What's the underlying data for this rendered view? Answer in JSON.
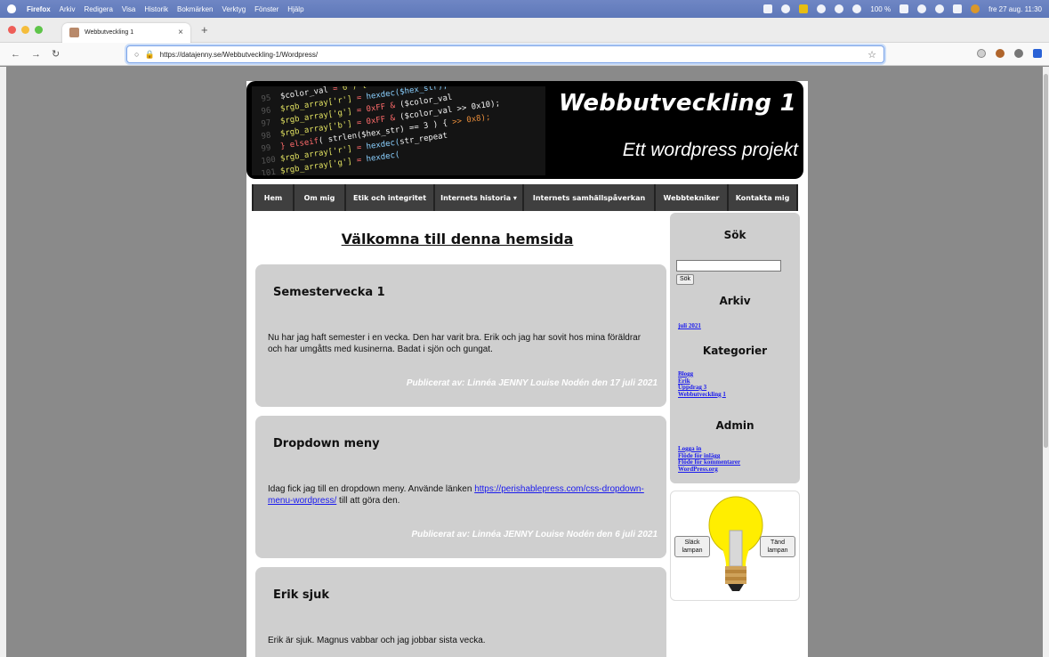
{
  "menubar": {
    "app": "Firefox",
    "items": [
      "Arkiv",
      "Redigera",
      "Visa",
      "Historik",
      "Bokmärken",
      "Verktyg",
      "Fönster",
      "Hjälp"
    ],
    "battery": "100 %",
    "clock": "fre 27 aug.  11:30"
  },
  "browser": {
    "tab_title": "Webbutveckling 1",
    "url": "https://datajenny.se/Webbutveckling-1/Wordpress/"
  },
  "site": {
    "title": "Webbutveckling 1",
    "tagline": "Ett wordpress projekt",
    "menu": [
      "Hem",
      "Om mig",
      "Etik och integritet",
      "Internets historia ▾",
      "Internets samhällspåverkan",
      "Webbtekniker",
      "Kontakta mig"
    ],
    "page_heading": "Välkomna till denna hemsida",
    "posts": [
      {
        "title": "Semestervecka 1",
        "body": "Nu har jag haft semester i en vecka. Den har varit bra. Erik och jag har sovit hos mina föräldrar och har umgåtts med kusinerna. Badat i sjön och gungat.",
        "meta": "Publicerat av: Linnéa JENNY Louise Nodén den 17 juli 2021"
      },
      {
        "title": "Dropdown meny",
        "body_before": "Idag fick jag till en dropdown meny. Använde länken ",
        "link": "https://perishablepress.com/css-dropdown-menu-wordpress/",
        "body_after": " till att göra den.",
        "meta": "Publicerat av: Linnéa JENNY Louise Nodén den 6 juli 2021"
      },
      {
        "title": "Erik sjuk",
        "body": "Erik är sjuk. Magnus vabbar och jag jobbar sista vecka."
      }
    ],
    "sidebar": {
      "search_heading": "Sök",
      "search_button": "Sök",
      "archive_heading": "Arkiv",
      "archive_links": [
        "juli 2021"
      ],
      "categories_heading": "Kategorier",
      "category_links": [
        "Blogg",
        "Erik",
        "Uppdrag 3",
        "Webbutveckling 1"
      ],
      "admin_heading": "Admin",
      "admin_links": [
        "Logga in",
        "Flöde för inlägg",
        "Flöde för kommentarer",
        "WordPress.org"
      ],
      "lamp_off": "Släck lampan",
      "lamp_on": "Tänd lampan"
    }
  },
  "colors": {
    "page_bg": "#8a8a8a",
    "post_bg": "#cfcfcf",
    "menu_bg": "#3f3f3f",
    "link": "#1a1aee",
    "bulb": "#ffee00"
  }
}
